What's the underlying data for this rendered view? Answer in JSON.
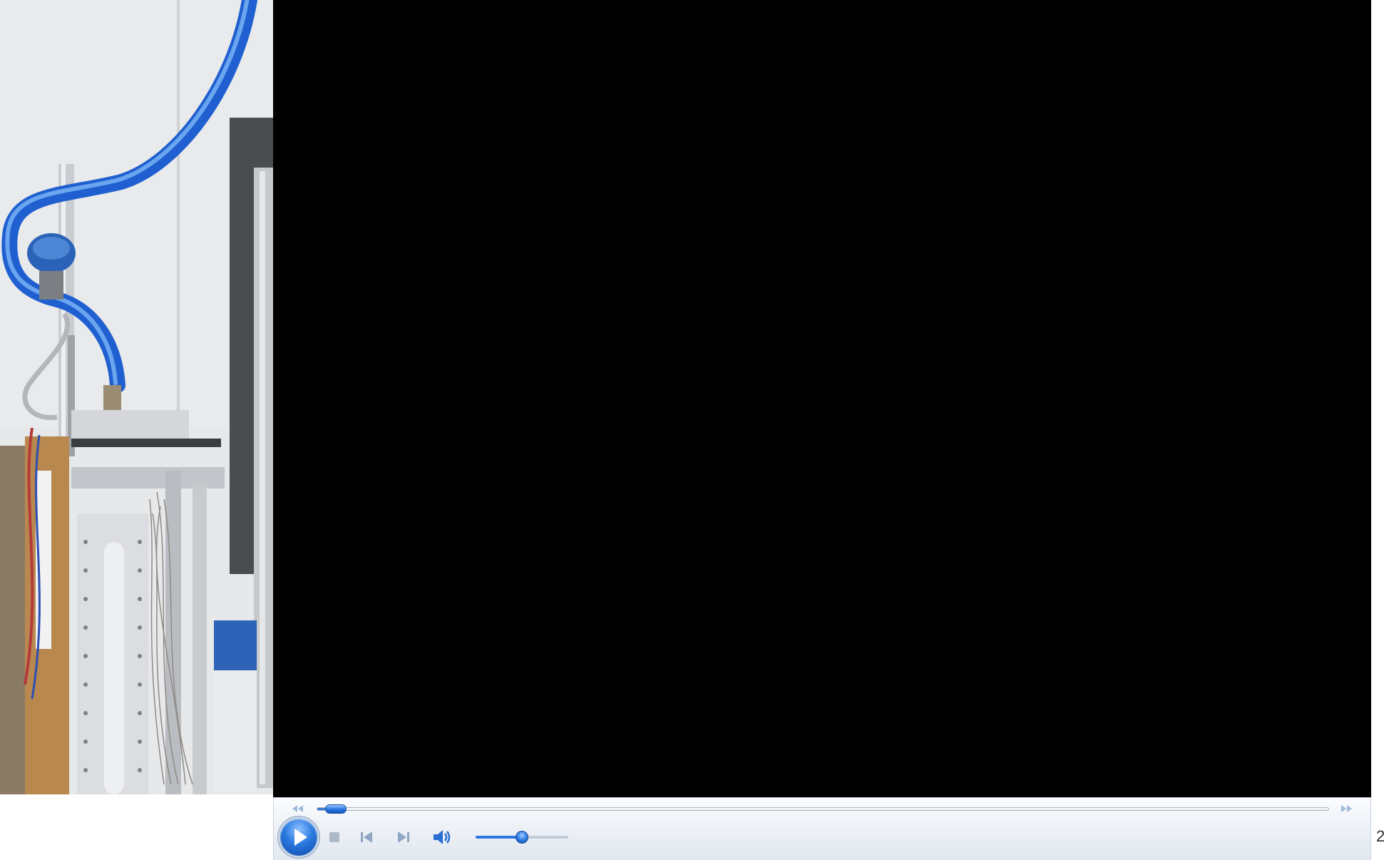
{
  "player": {
    "video_background": "#000000",
    "accent": "#2a77df",
    "progress": 0.01,
    "volume": 0.5,
    "state": "paused"
  },
  "controls": {
    "seek_back_icon": "rewind-icon",
    "seek_forward_icon": "fast-forward-icon",
    "play_icon": "play-icon",
    "stop_icon": "stop-icon",
    "previous_icon": "previous-track-icon",
    "next_icon": "next-track-icon",
    "volume_icon": "speaker-icon"
  },
  "time_display": "2"
}
